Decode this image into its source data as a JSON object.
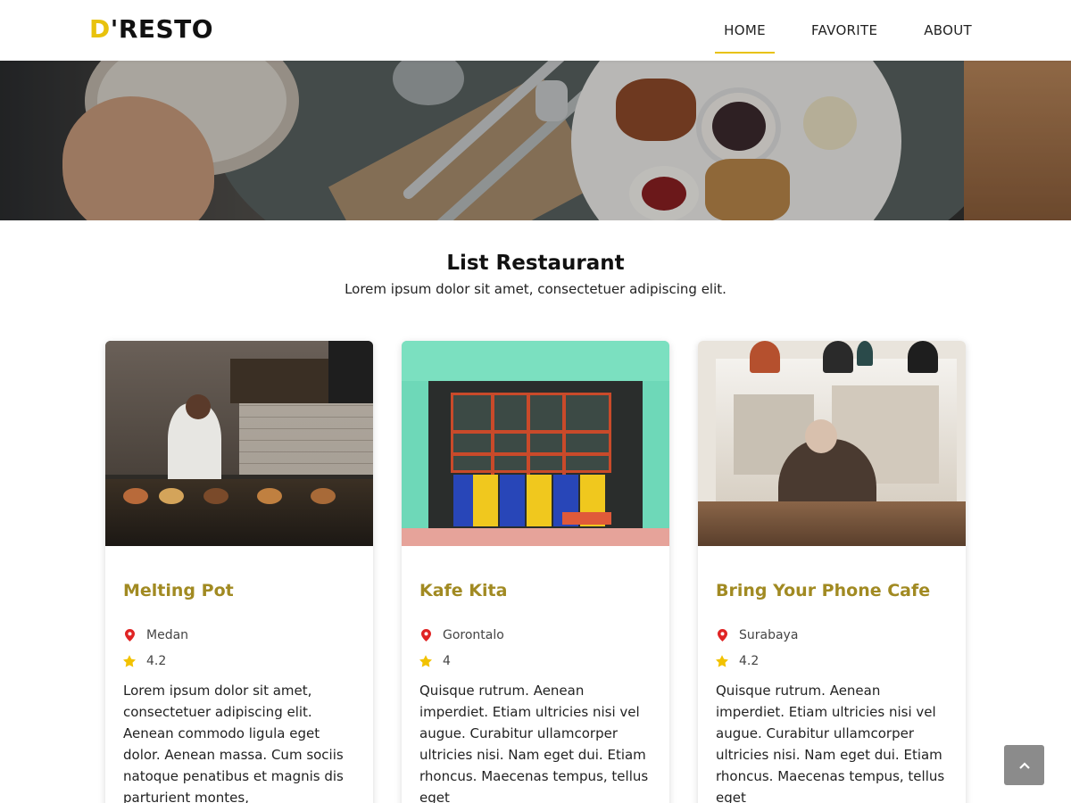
{
  "brand": {
    "first_letter": "D",
    "rest": "'RESTO",
    "accent_color": "#e8c20d"
  },
  "nav": [
    {
      "label": "HOME",
      "active": true
    },
    {
      "label": "FAVORITE",
      "active": false
    },
    {
      "label": "ABOUT",
      "active": false
    }
  ],
  "section": {
    "title": "List Restaurant",
    "subtitle": "Lorem ipsum dolor sit amet, consectetuer adipiscing elit."
  },
  "restaurants": [
    {
      "name": "Melting Pot",
      "city": "Medan",
      "rating": "4.2",
      "description": "Lorem ipsum dolor sit amet, consectetuer adipiscing elit. Aenean commodo ligula eget dolor. Aenean massa. Cum sociis natoque penatibus et magnis dis parturient montes,"
    },
    {
      "name": "Kafe Kita",
      "city": "Gorontalo",
      "rating": "4",
      "description": "Quisque rutrum. Aenean imperdiet. Etiam ultricies nisi vel augue. Curabitur ullamcorper ultricies nisi. Nam eget dui. Etiam rhoncus. Maecenas tempus, tellus eget"
    },
    {
      "name": "Bring Your Phone Cafe",
      "city": "Surabaya",
      "rating": "4.2",
      "description": "Quisque rutrum. Aenean imperdiet. Etiam ultricies nisi vel augue. Curabitur ullamcorper ultricies nisi. Nam eget dui. Etiam rhoncus. Maecenas tempus, tellus eget"
    }
  ],
  "icons": {
    "location": "map-pin-icon",
    "rating": "star-icon",
    "back_to_top": "chevron-up-icon"
  },
  "colors": {
    "restaurant_name": "#a18a22",
    "pin": "#e02424",
    "star": "#f2c200",
    "back_to_top_bg": "#8b8b8b"
  }
}
